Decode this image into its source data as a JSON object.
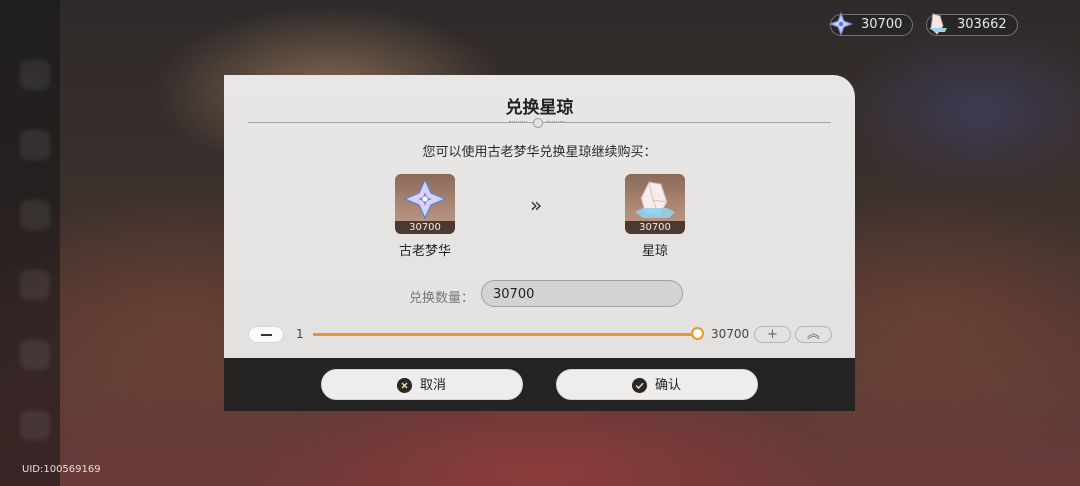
{
  "currency": {
    "dreams": {
      "icon": "ancient-dream-icon",
      "value": "30700"
    },
    "jade": {
      "icon": "stellar-jade-icon",
      "value": "303662"
    }
  },
  "uid": "UID:100569169",
  "dialog": {
    "title": "兑换星琼",
    "subtitle": "您可以使用古老梦华兑换星琼继续购买：",
    "from_item": {
      "icon": "ancient-dream-icon",
      "quantity": "30700",
      "label": "古老梦华"
    },
    "to_item": {
      "icon": "stellar-jade-icon",
      "quantity": "30700",
      "label": "星琼"
    },
    "arrow": "»",
    "quantity_label": "兑换数量：",
    "quantity_value": "30700",
    "slider": {
      "min_label": "1",
      "max_label": "30700",
      "fraction": 1.0
    },
    "plus_label": "+",
    "max_label": "︽",
    "cancel_label": "取消",
    "confirm_label": "确认"
  }
}
